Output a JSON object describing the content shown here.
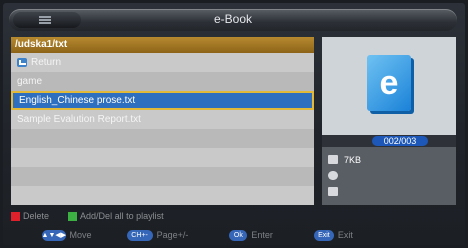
{
  "header": {
    "title": "e-Book"
  },
  "path": "/udska1/txt",
  "files": [
    {
      "label": "Return",
      "type": "return"
    },
    {
      "label": "game",
      "type": "folder"
    },
    {
      "label": "English_Chinese prose.txt",
      "type": "file",
      "selected": true
    },
    {
      "label": "Sample Evalution Report.txt",
      "type": "file"
    }
  ],
  "preview": {
    "icon_letter": "e",
    "counter": "002/003"
  },
  "info": {
    "size": "7KB"
  },
  "legend": {
    "delete": "Delete",
    "add_del": "Add/Del all to playlist",
    "delete_color": "#e0202a",
    "add_color": "#3cb043"
  },
  "controls": {
    "move_key": "▲▼◀▶",
    "move_label": "Move",
    "page_key": "CH+-",
    "page_label": "Page+/-",
    "ok_key": "Ok",
    "ok_label": "Enter",
    "exit_key": "Exit",
    "exit_label": "Exit"
  }
}
